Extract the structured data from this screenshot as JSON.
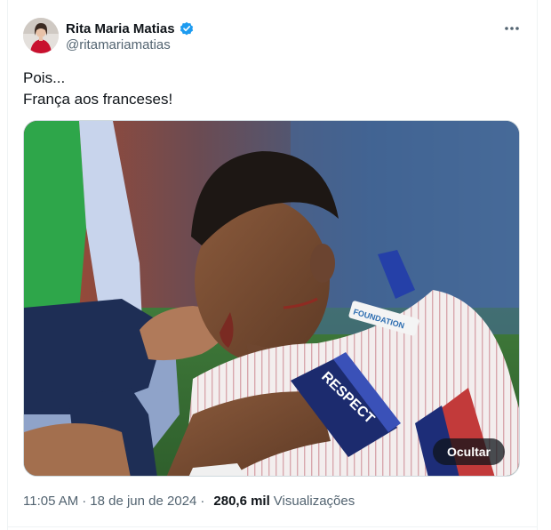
{
  "author": {
    "display_name": "Rita Maria Matias",
    "handle": "@ritamariamatias",
    "verified": true
  },
  "tweet": {
    "lines": [
      "Pois...",
      "França aos franceses!"
    ]
  },
  "media": {
    "hide_label": "Ocultar",
    "armband_text": "RESPECT",
    "shirt_patch_text": "FOUNDATION"
  },
  "meta": {
    "time": "11:05 AM",
    "date": "18 de jun de 2024",
    "separator": "·",
    "views_count": "280,6 mil",
    "views_label": "Visualizações"
  },
  "colors": {
    "verified_blue": "#1d9bf0",
    "text_primary": "#0f1419",
    "text_secondary": "#536471"
  },
  "icons": {
    "more": "more-horizontal-icon",
    "verified": "verified-badge-icon"
  }
}
